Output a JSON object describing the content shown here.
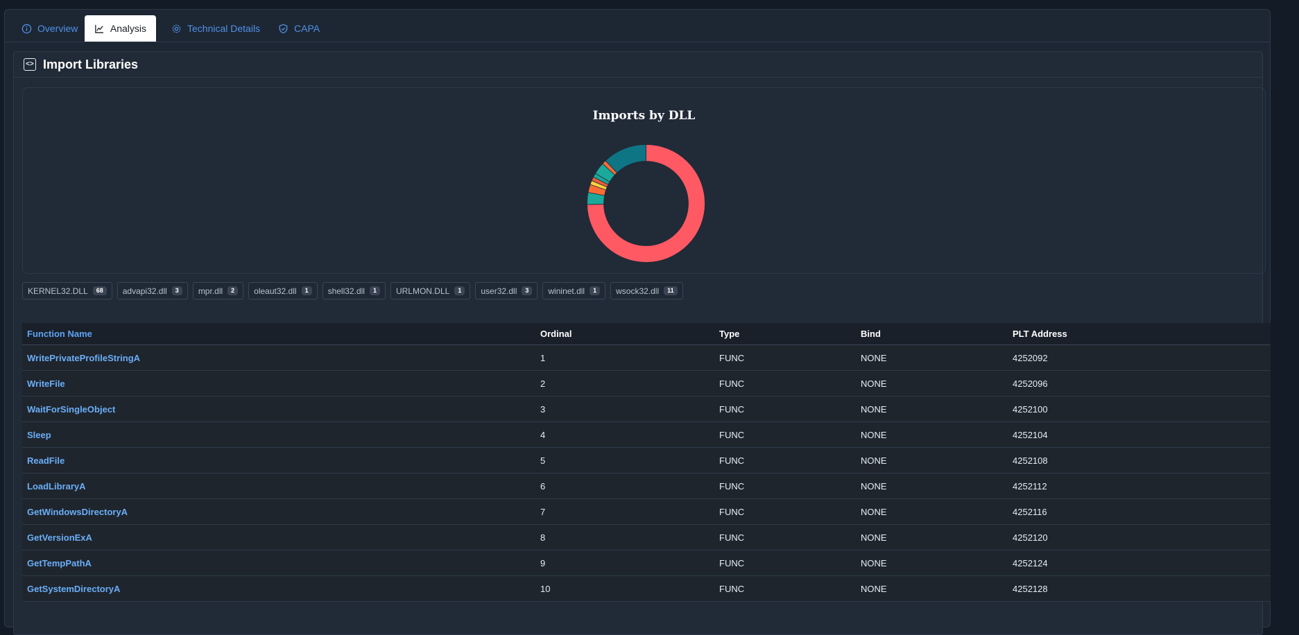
{
  "tabs": [
    {
      "label": "Overview",
      "icon": "info-icon"
    },
    {
      "label": "Analysis",
      "icon": "chart-line-icon",
      "active": true
    },
    {
      "label": "Technical Details",
      "icon": "gear-icon"
    },
    {
      "label": "CAPA",
      "icon": "shield-icon"
    }
  ],
  "section": {
    "title": "Import Libraries",
    "icon": "code-icon"
  },
  "chart_data": {
    "type": "pie",
    "title": "Imports by DLL",
    "categories": [
      "KERNEL32.DLL",
      "advapi32.dll",
      "mpr.dll",
      "oleaut32.dll",
      "shell32.dll",
      "URLMON.DLL",
      "user32.dll",
      "wininet.dll",
      "wsock32.dll"
    ],
    "values": [
      68,
      3,
      2,
      1,
      1,
      1,
      3,
      1,
      11
    ],
    "colors": [
      "#ff5964",
      "#1aa99b",
      "#ff6b35",
      "#ffd23f",
      "#e85d3a",
      "#1aa99b",
      "#1aa99b",
      "#ff6b35",
      "#0e7585"
    ],
    "donut": true
  },
  "dlls": [
    {
      "name": "KERNEL32.DLL",
      "count": "68"
    },
    {
      "name": "advapi32.dll",
      "count": "3"
    },
    {
      "name": "mpr.dll",
      "count": "2"
    },
    {
      "name": "oleaut32.dll",
      "count": "1"
    },
    {
      "name": "shell32.dll",
      "count": "1"
    },
    {
      "name": "URLMON.DLL",
      "count": "1"
    },
    {
      "name": "user32.dll",
      "count": "3"
    },
    {
      "name": "wininet.dll",
      "count": "1"
    },
    {
      "name": "wsock32.dll",
      "count": "11"
    }
  ],
  "table": {
    "headers": [
      "Function Name",
      "Ordinal",
      "Type",
      "Bind",
      "PLT Address"
    ],
    "rows": [
      [
        "WritePrivateProfileStringA",
        "1",
        "FUNC",
        "NONE",
        "4252092"
      ],
      [
        "WriteFile",
        "2",
        "FUNC",
        "NONE",
        "4252096"
      ],
      [
        "WaitForSingleObject",
        "3",
        "FUNC",
        "NONE",
        "4252100"
      ],
      [
        "Sleep",
        "4",
        "FUNC",
        "NONE",
        "4252104"
      ],
      [
        "ReadFile",
        "5",
        "FUNC",
        "NONE",
        "4252108"
      ],
      [
        "LoadLibraryA",
        "6",
        "FUNC",
        "NONE",
        "4252112"
      ],
      [
        "GetWindowsDirectoryA",
        "7",
        "FUNC",
        "NONE",
        "4252116"
      ],
      [
        "GetVersionExA",
        "8",
        "FUNC",
        "NONE",
        "4252120"
      ],
      [
        "GetTempPathA",
        "9",
        "FUNC",
        "NONE",
        "4252124"
      ],
      [
        "GetSystemDirectoryA",
        "10",
        "FUNC",
        "NONE",
        "4252128"
      ]
    ]
  }
}
